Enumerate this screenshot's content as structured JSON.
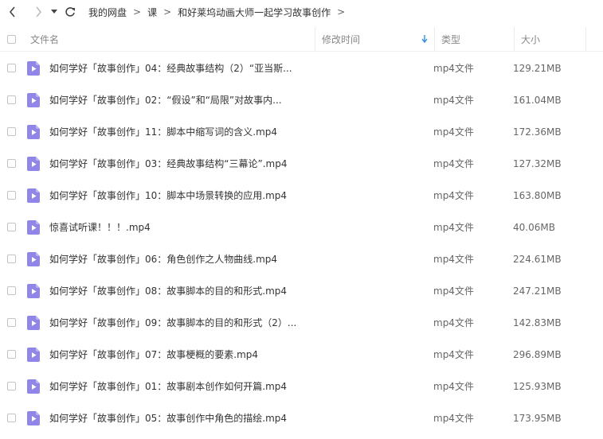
{
  "toolbar": {
    "back_icon": "chevron-left-icon",
    "forward_icon": "chevron-right-icon",
    "history_icon": "caret-down-icon",
    "refresh_icon": "refresh-icon",
    "breadcrumbs": [
      "我的网盘",
      "课",
      "和好莱坞动画大师一起学习故事创作"
    ],
    "separator": ">"
  },
  "columns": {
    "name": "文件名",
    "modified": "修改时间",
    "type": "类型",
    "size": "大小",
    "sort_icon": "sort-down-arrow-icon"
  },
  "colors": {
    "accent": "#2b8de8",
    "file_icon": "#8f86e8"
  },
  "files": [
    {
      "name": "如何学好「故事创作」04：经典故事结构（2）“亚当斯...",
      "type": "mp4文件",
      "size": "129.21MB"
    },
    {
      "name": "如何学好「故事创作」02：“假设”和“局限”对故事内...",
      "type": "mp4文件",
      "size": "161.04MB"
    },
    {
      "name": "如何学好「故事创作」11：脚本中缩写词的含义.mp4",
      "type": "mp4文件",
      "size": "172.36MB"
    },
    {
      "name": "如何学好「故事创作」03：经典故事结构“三幕论”.mp4",
      "type": "mp4文件",
      "size": "127.32MB"
    },
    {
      "name": "如何学好「故事创作」10：脚本中场景转换的应用.mp4",
      "type": "mp4文件",
      "size": "163.80MB"
    },
    {
      "name": "惊喜试听课！！！.mp4",
      "type": "mp4文件",
      "size": "40.06MB"
    },
    {
      "name": "如何学好「故事创作」06：角色创作之人物曲线.mp4",
      "type": "mp4文件",
      "size": "224.61MB"
    },
    {
      "name": "如何学好「故事创作」08：故事脚本的目的和形式.mp4",
      "type": "mp4文件",
      "size": "247.21MB"
    },
    {
      "name": "如何学好「故事创作」09：故事脚本的目的和形式（2）...",
      "type": "mp4文件",
      "size": "142.83MB"
    },
    {
      "name": "如何学好「故事创作」07：故事梗概的要素.mp4",
      "type": "mp4文件",
      "size": "296.89MB"
    },
    {
      "name": "如何学好「故事创作」01：故事剧本创作如何开篇.mp4",
      "type": "mp4文件",
      "size": "125.93MB"
    },
    {
      "name": "如何学好「故事创作」05：故事创作中角色的描绘.mp4",
      "type": "mp4文件",
      "size": "173.95MB"
    }
  ]
}
